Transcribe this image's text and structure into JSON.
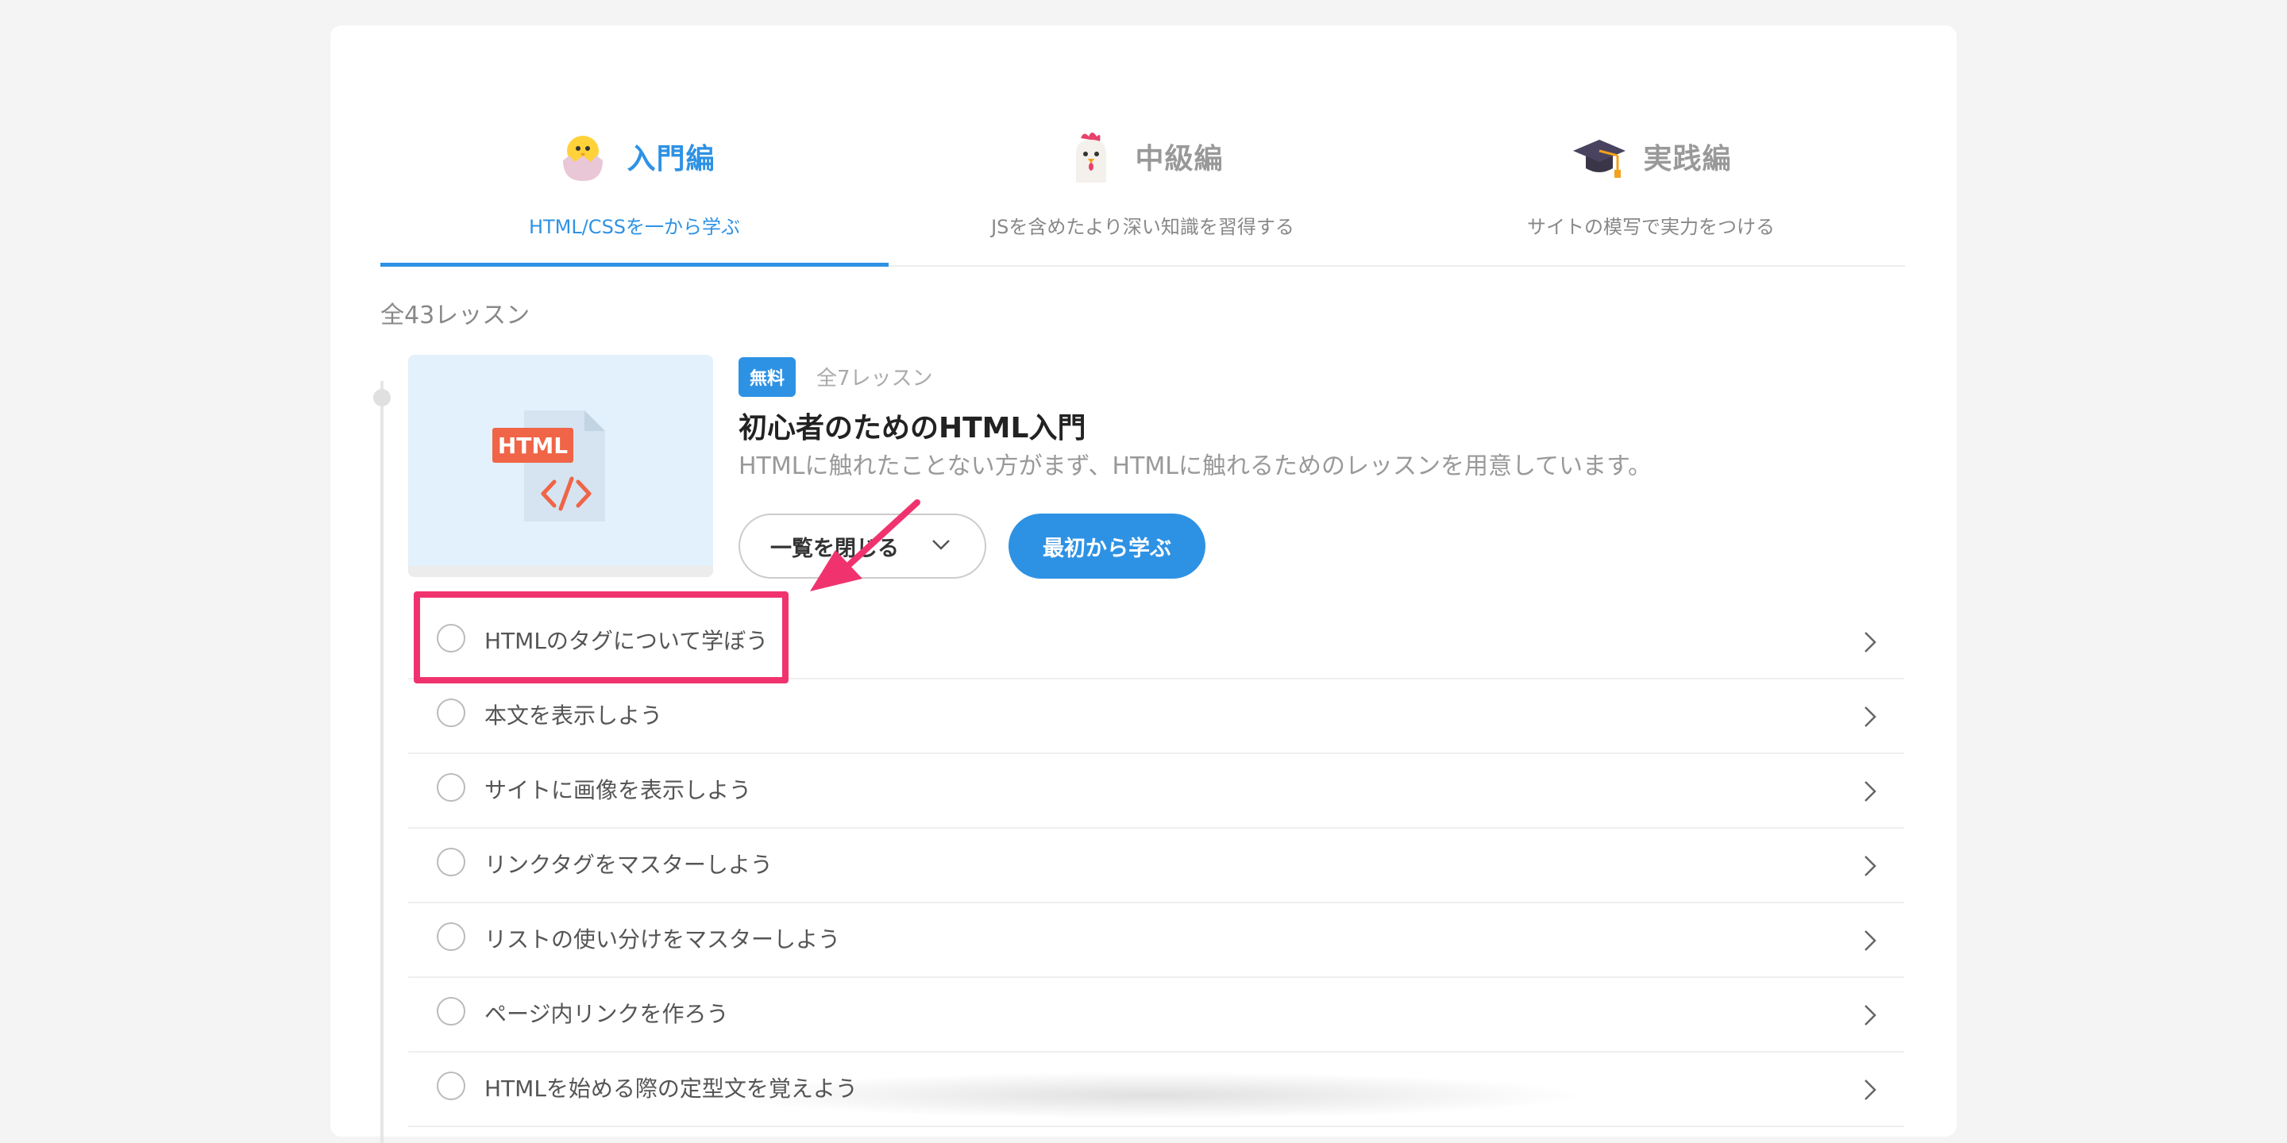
{
  "tabs": [
    {
      "title": "入門編",
      "subtitle": "HTML/CSSを一から学ぶ",
      "icon": "chick-icon",
      "active": true
    },
    {
      "title": "中級編",
      "subtitle": "JSを含めたより深い知識を習得する",
      "icon": "chicken-icon",
      "active": false
    },
    {
      "title": "実践編",
      "subtitle": "サイトの模写で実力をつける",
      "icon": "graduation-cap-icon",
      "active": false
    }
  ],
  "total_lessons": "全43レッスン",
  "course": {
    "thumbnail_label": "HTML",
    "badge": "無料",
    "lesson_count": "全7レッスン",
    "title": "初心者のためのHTML入門",
    "description": "HTMLに触れたことない方がまず、HTMLに触れるためのレッスンを用意しています。",
    "list_button": "一覧を閉じる",
    "start_button": "最初から学ぶ"
  },
  "lessons": [
    "HTMLのタグについて学ぼう",
    "本文を表示しよう",
    "サイトに画像を表示しよう",
    "リンクタグをマスターしよう",
    "リストの使い分けをマスターしよう",
    "ページ内リンクを作ろう",
    "HTMLを始める際の定型文を覚えよう"
  ],
  "colors": {
    "accent": "#2e92e4",
    "highlight": "#f0336f"
  }
}
